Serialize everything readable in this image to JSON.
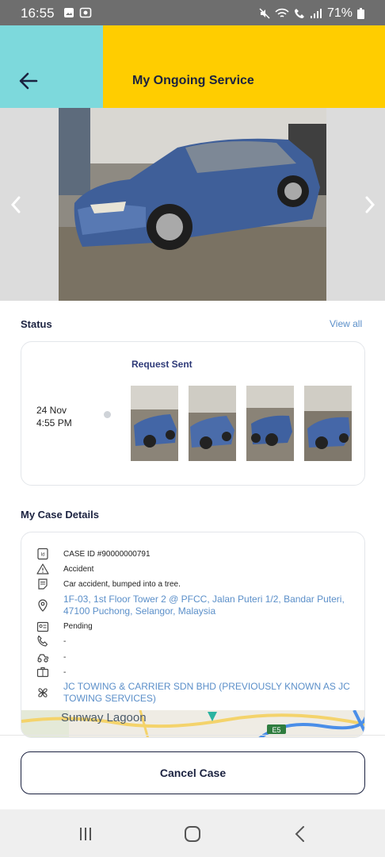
{
  "status_bar": {
    "time": "16:55",
    "battery": "71%"
  },
  "header": {
    "title": "My Ongoing Service"
  },
  "status_section": {
    "heading": "Status",
    "view_all": "View all",
    "entry": {
      "date": "24 Nov",
      "time": "4:55 PM",
      "label": "Request Sent"
    }
  },
  "case_details": {
    "heading": "My Case Details",
    "case_id": "CASE ID #90000000791",
    "type": "Accident",
    "description": "Car accident, bumped into a tree.",
    "address": "1F-03, 1st Floor Tower 2 @ PFCC, Jalan Puteri 1/2, Bandar Puteri, 47100 Puchong, Selangor, Malaysia",
    "status": "Pending",
    "phone": "-",
    "vehicle": "-",
    "bag": "-",
    "provider": "JC TOWING & CARRIER SDN BHD (PREVIOUSLY KNOWN AS JC TOWING SERVICES)"
  },
  "map": {
    "place_label": "Sunway Lagoon",
    "road_label": "E5"
  },
  "footer": {
    "cancel_label": "Cancel Case"
  },
  "colors": {
    "header_left": "#7dd9dc",
    "header_right": "#ffcd00",
    "link": "#5b8fc9",
    "navy": "#1b2240"
  }
}
